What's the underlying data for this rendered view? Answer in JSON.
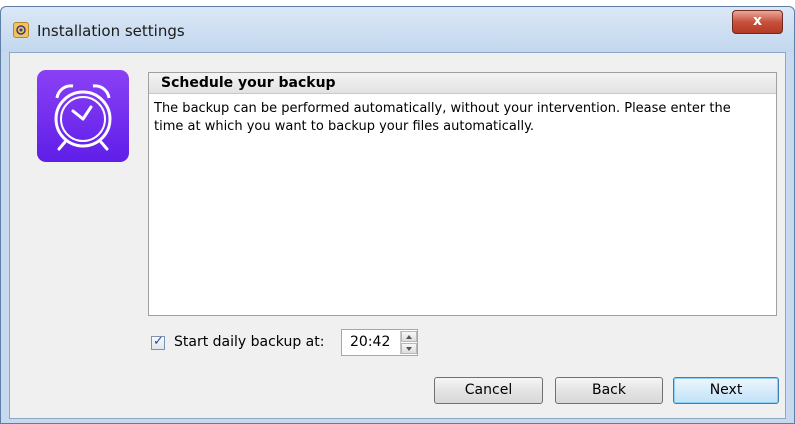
{
  "window": {
    "title": "Installation settings",
    "close_glyph": "x"
  },
  "panel": {
    "title": "Schedule your backup",
    "description": "The backup can be performed automatically, without your intervention. Please enter the time at which you want to backup your files automatically."
  },
  "schedule": {
    "checkbox_checked": true,
    "checkbox_glyph": "✓",
    "label": "Start daily backup at:",
    "time": "20:42"
  },
  "buttons": {
    "cancel": "Cancel",
    "back": "Back",
    "next": "Next"
  },
  "icons": {
    "app": "gear-icon",
    "hero": "alarm-clock-icon"
  },
  "colors": {
    "clock_tile": "#6a2af0",
    "titlebar": "#c6d9ee",
    "close_button": "#c7513d",
    "default_button_border": "#3c7fb1"
  }
}
